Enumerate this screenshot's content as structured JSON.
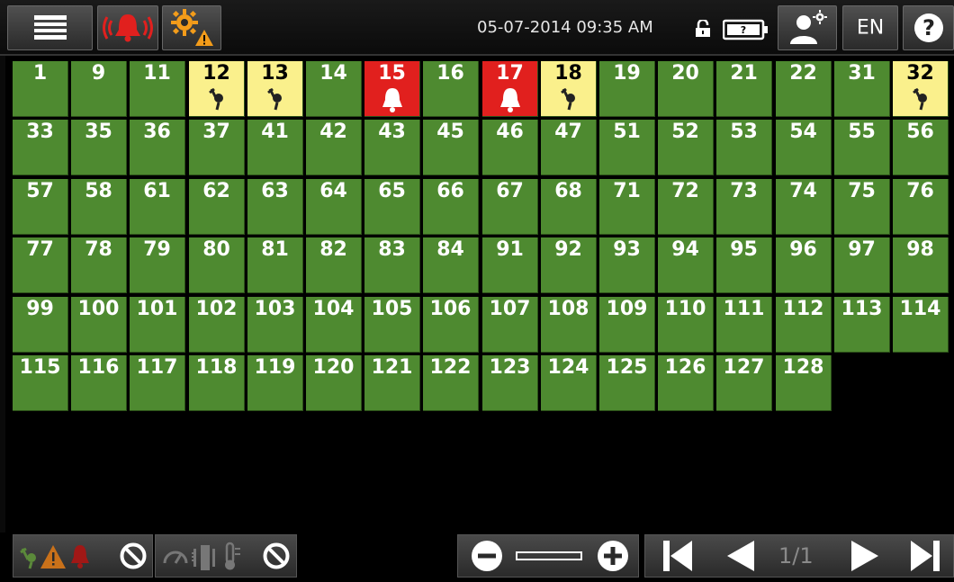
{
  "header": {
    "menu_icon": "hamburger-menu-icon",
    "alarm_icon": "alarm-bell-icon",
    "settings_warning_icon": "settings-warning-icon",
    "datetime": "05-07-2014 09:35 AM",
    "lock_icon": "unlocked-padlock-icon",
    "battery_icon": "battery-unknown-icon",
    "user_settings_icon": "user-settings-icon",
    "language": "EN",
    "help_icon": "help-icon"
  },
  "colors": {
    "ok": "#4e8a30",
    "warning": "#faf08c",
    "alarm": "#e1201e"
  },
  "tiles": [
    {
      "label": "1",
      "status": "ok"
    },
    {
      "label": "9",
      "status": "ok"
    },
    {
      "label": "11",
      "status": "ok"
    },
    {
      "label": "12",
      "status": "warning",
      "icon": "probe-icon"
    },
    {
      "label": "13",
      "status": "warning",
      "icon": "probe-icon"
    },
    {
      "label": "14",
      "status": "ok"
    },
    {
      "label": "15",
      "status": "alarm",
      "icon": "bell-icon"
    },
    {
      "label": "16",
      "status": "ok"
    },
    {
      "label": "17",
      "status": "alarm",
      "icon": "bell-icon"
    },
    {
      "label": "18",
      "status": "warning",
      "icon": "probe-icon"
    },
    {
      "label": "19",
      "status": "ok"
    },
    {
      "label": "20",
      "status": "ok"
    },
    {
      "label": "21",
      "status": "ok"
    },
    {
      "label": "22",
      "status": "ok"
    },
    {
      "label": "31",
      "status": "ok"
    },
    {
      "label": "32",
      "status": "warning",
      "icon": "probe-icon"
    },
    {
      "label": "33",
      "status": "ok"
    },
    {
      "label": "35",
      "status": "ok"
    },
    {
      "label": "36",
      "status": "ok"
    },
    {
      "label": "37",
      "status": "ok"
    },
    {
      "label": "41",
      "status": "ok"
    },
    {
      "label": "42",
      "status": "ok"
    },
    {
      "label": "43",
      "status": "ok"
    },
    {
      "label": "45",
      "status": "ok"
    },
    {
      "label": "46",
      "status": "ok"
    },
    {
      "label": "47",
      "status": "ok"
    },
    {
      "label": "51",
      "status": "ok"
    },
    {
      "label": "52",
      "status": "ok"
    },
    {
      "label": "53",
      "status": "ok"
    },
    {
      "label": "54",
      "status": "ok"
    },
    {
      "label": "55",
      "status": "ok"
    },
    {
      "label": "56",
      "status": "ok"
    },
    {
      "label": "57",
      "status": "ok"
    },
    {
      "label": "58",
      "status": "ok"
    },
    {
      "label": "61",
      "status": "ok"
    },
    {
      "label": "62",
      "status": "ok"
    },
    {
      "label": "63",
      "status": "ok"
    },
    {
      "label": "64",
      "status": "ok"
    },
    {
      "label": "65",
      "status": "ok"
    },
    {
      "label": "66",
      "status": "ok"
    },
    {
      "label": "67",
      "status": "ok"
    },
    {
      "label": "68",
      "status": "ok"
    },
    {
      "label": "71",
      "status": "ok"
    },
    {
      "label": "72",
      "status": "ok"
    },
    {
      "label": "73",
      "status": "ok"
    },
    {
      "label": "74",
      "status": "ok"
    },
    {
      "label": "75",
      "status": "ok"
    },
    {
      "label": "76",
      "status": "ok"
    },
    {
      "label": "77",
      "status": "ok"
    },
    {
      "label": "78",
      "status": "ok"
    },
    {
      "label": "79",
      "status": "ok"
    },
    {
      "label": "80",
      "status": "ok"
    },
    {
      "label": "81",
      "status": "ok"
    },
    {
      "label": "82",
      "status": "ok"
    },
    {
      "label": "83",
      "status": "ok"
    },
    {
      "label": "84",
      "status": "ok"
    },
    {
      "label": "91",
      "status": "ok"
    },
    {
      "label": "92",
      "status": "ok"
    },
    {
      "label": "93",
      "status": "ok"
    },
    {
      "label": "94",
      "status": "ok"
    },
    {
      "label": "95",
      "status": "ok"
    },
    {
      "label": "96",
      "status": "ok"
    },
    {
      "label": "97",
      "status": "ok"
    },
    {
      "label": "98",
      "status": "ok"
    },
    {
      "label": "99",
      "status": "ok"
    },
    {
      "label": "100",
      "status": "ok"
    },
    {
      "label": "101",
      "status": "ok"
    },
    {
      "label": "102",
      "status": "ok"
    },
    {
      "label": "103",
      "status": "ok"
    },
    {
      "label": "104",
      "status": "ok"
    },
    {
      "label": "105",
      "status": "ok"
    },
    {
      "label": "106",
      "status": "ok"
    },
    {
      "label": "107",
      "status": "ok"
    },
    {
      "label": "108",
      "status": "ok"
    },
    {
      "label": "109",
      "status": "ok"
    },
    {
      "label": "110",
      "status": "ok"
    },
    {
      "label": "111",
      "status": "ok"
    },
    {
      "label": "112",
      "status": "ok"
    },
    {
      "label": "113",
      "status": "ok"
    },
    {
      "label": "114",
      "status": "ok"
    },
    {
      "label": "115",
      "status": "ok"
    },
    {
      "label": "116",
      "status": "ok"
    },
    {
      "label": "117",
      "status": "ok"
    },
    {
      "label": "118",
      "status": "ok"
    },
    {
      "label": "119",
      "status": "ok"
    },
    {
      "label": "120",
      "status": "ok"
    },
    {
      "label": "121",
      "status": "ok"
    },
    {
      "label": "122",
      "status": "ok"
    },
    {
      "label": "123",
      "status": "ok"
    },
    {
      "label": "124",
      "status": "ok"
    },
    {
      "label": "125",
      "status": "ok"
    },
    {
      "label": "126",
      "status": "ok"
    },
    {
      "label": "127",
      "status": "ok"
    },
    {
      "label": "128",
      "status": "ok"
    }
  ],
  "footer": {
    "filter_status_icons": [
      "probe-icon",
      "warning-triangle-icon",
      "bell-icon",
      "prohibit-icon"
    ],
    "filter_sensor_icons": [
      "gauge-icon",
      "valve-icon",
      "thermometer-icon",
      "prohibit-icon"
    ],
    "zoom_out_icon": "zoom-out-icon",
    "zoom_in_icon": "zoom-in-icon",
    "first_page_icon": "first-page-icon",
    "prev_page_icon": "previous-page-icon",
    "page_indicator": "1/1",
    "next_page_icon": "next-page-icon",
    "last_page_icon": "last-page-icon"
  }
}
